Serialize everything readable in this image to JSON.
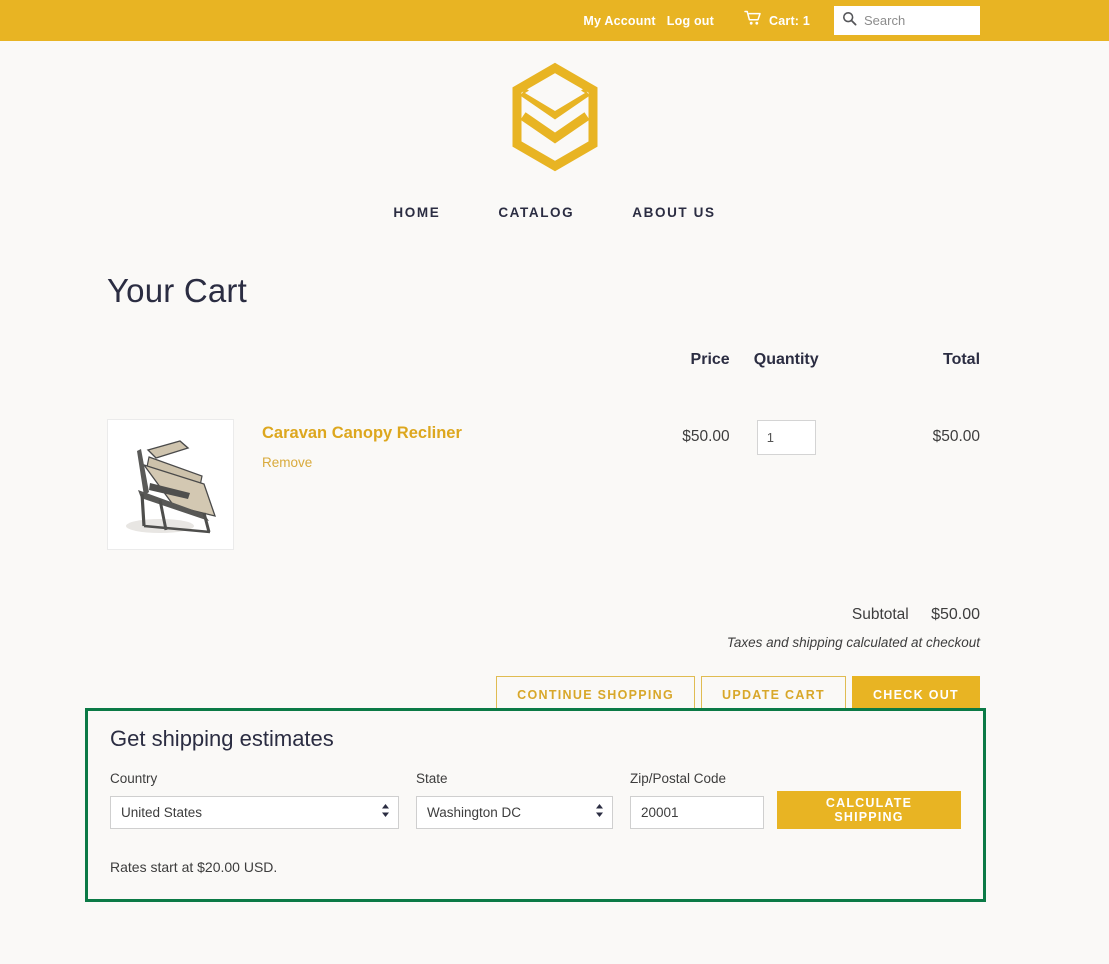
{
  "topbar": {
    "my_account": "My Account",
    "log_out": "Log out",
    "cart_label": "Cart: 1",
    "cart_icon": "shopping-cart-icon",
    "search_icon": "search-icon",
    "search_placeholder": "Search",
    "search_value": "",
    "background_color": "#e8b423"
  },
  "brand": {
    "logo_icon": "hexagon-layers-logo",
    "logo_color": "#e8b423"
  },
  "nav": {
    "items": [
      {
        "label": "HOME"
      },
      {
        "label": "CATALOG"
      },
      {
        "label": "ABOUT US"
      }
    ]
  },
  "page": {
    "title": "Your Cart"
  },
  "cart": {
    "columns": {
      "product": "",
      "price": "Price",
      "quantity": "Quantity",
      "total": "Total"
    },
    "items": [
      {
        "image_alt": "reclining-lounge-chair",
        "title": "Caravan Canopy Recliner",
        "remove_label": "Remove",
        "price": "$50.00",
        "quantity": "1",
        "total": "$50.00"
      }
    ],
    "subtotal_label": "Subtotal",
    "subtotal_value": "$50.00",
    "tax_note": "Taxes and shipping calculated at checkout",
    "buttons": {
      "continue_shopping": "CONTINUE SHOPPING",
      "update_cart": "UPDATE CART",
      "check_out": "CHECK OUT"
    },
    "accent_color": "#e8b423",
    "link_color": "#dda71e"
  },
  "shipping": {
    "title": "Get shipping estimates",
    "country_label": "Country",
    "country_value": "United States",
    "country_options": [
      "United States"
    ],
    "state_label": "State",
    "state_value": "Washington DC",
    "state_options": [
      "Washington DC"
    ],
    "zip_label": "Zip/Postal Code",
    "zip_value": "20001",
    "zip_placeholder": "",
    "calculate_label": "CALCULATE SHIPPING",
    "rates_note": "Rates start at $20.00 USD.",
    "highlight_border_color": "#0b7a46"
  }
}
